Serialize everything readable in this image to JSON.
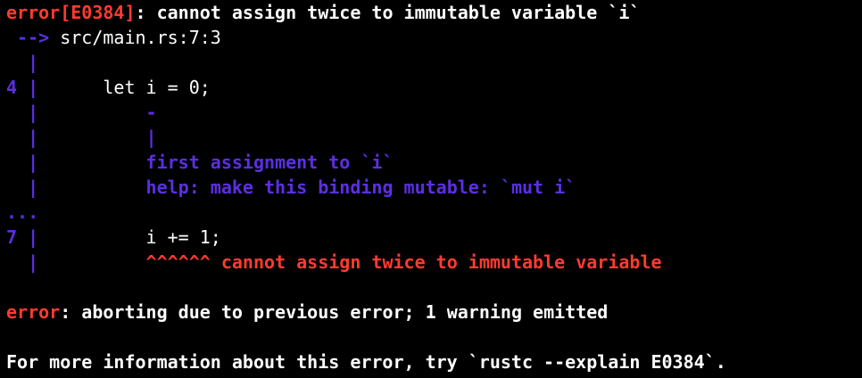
{
  "colors": {
    "background": "#000000",
    "error_red": "#ff3b30",
    "note_blue": "#5b2fe3",
    "text_white": "#ffffff"
  },
  "error_header": {
    "code": "error[E0384]",
    "message": ": cannot assign twice to immutable variable `i`"
  },
  "location": {
    "arrow": " -->",
    "path": " src/main.rs:7:3"
  },
  "gutter_bar": "  |",
  "gutter_ellipsis": "...",
  "source_line_4": {
    "number": "4 |",
    "code": "      let i = 0;"
  },
  "marker_dash": "-",
  "marker_bar": "|",
  "note_first_assignment": "first assignment to `i`",
  "help_text": "help: make this binding mutable: `mut i`",
  "source_line_7": {
    "number": "7 |",
    "code": "          i += 1;"
  },
  "error_carets": "^^^^^^",
  "error_inline_message": " cannot assign twice to immutable variable",
  "abort": {
    "label": "error",
    "message": ": aborting due to previous error; 1 warning emitted"
  },
  "more_info": "For more information about this error, try `rustc --explain E0384`."
}
